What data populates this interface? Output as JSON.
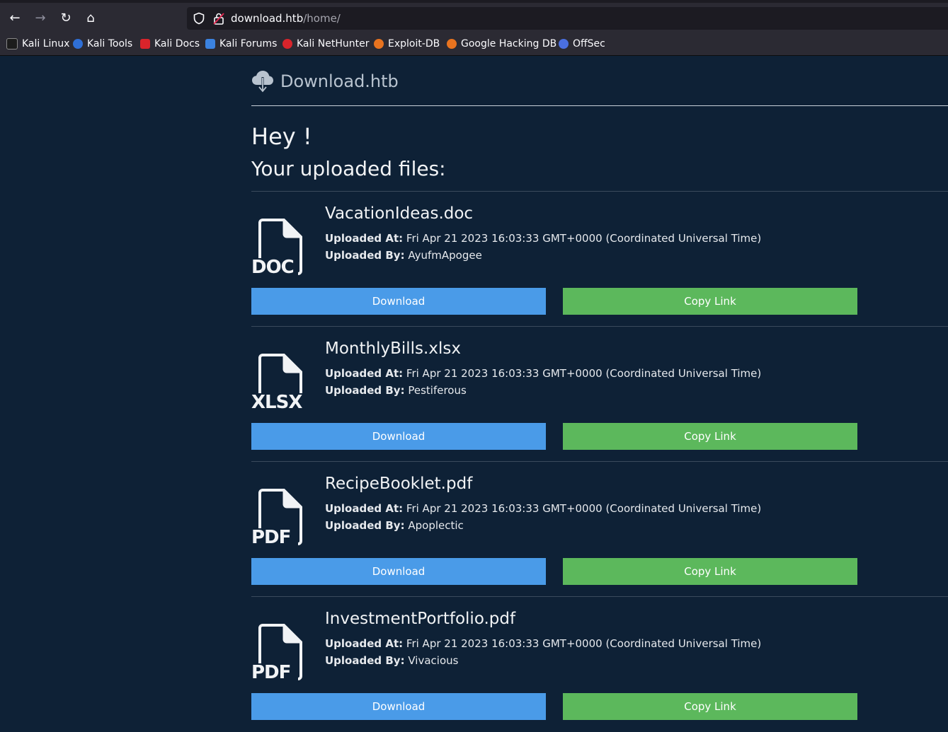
{
  "browser": {
    "url_host": "download.htb",
    "url_path": "/home/",
    "bookmarks": [
      {
        "label": "Kali Linux",
        "icon": "kali-dragon-icon",
        "color": "#1c1c1c"
      },
      {
        "label": "Kali Tools",
        "icon": "kali-tools-icon",
        "color": "#2f6fd6"
      },
      {
        "label": "Kali Docs",
        "icon": "kali-docs-icon",
        "color": "#d9242b"
      },
      {
        "label": "Kali Forums",
        "icon": "kali-forums-icon",
        "color": "#3b82e0"
      },
      {
        "label": "Kali NetHunter",
        "icon": "nethunter-icon",
        "color": "#d9242b"
      },
      {
        "label": "Exploit-DB",
        "icon": "exploit-db-icon",
        "color": "#e8731f"
      },
      {
        "label": "Google Hacking DB",
        "icon": "ghdb-icon",
        "color": "#e8731f"
      },
      {
        "label": "OffSec",
        "icon": "offsec-icon",
        "color": "#4a6fe0"
      }
    ]
  },
  "site": {
    "brand": "Download.htb",
    "greeting": "Hey !",
    "subtitle": "Your uploaded files:"
  },
  "labels": {
    "uploaded_at": "Uploaded At:",
    "uploaded_by": "Uploaded By:",
    "download": "Download",
    "copy_link": "Copy Link"
  },
  "files": [
    {
      "name": "VacationIdeas.doc",
      "ext": "DOC",
      "uploaded_at": "Fri Apr 21 2023 16:03:33 GMT+0000 (Coordinated Universal Time)",
      "uploaded_by": "AyufmApogee"
    },
    {
      "name": "MonthlyBills.xlsx",
      "ext": "XLSX",
      "uploaded_at": "Fri Apr 21 2023 16:03:33 GMT+0000 (Coordinated Universal Time)",
      "uploaded_by": "Pestiferous"
    },
    {
      "name": "RecipeBooklet.pdf",
      "ext": "PDF",
      "uploaded_at": "Fri Apr 21 2023 16:03:33 GMT+0000 (Coordinated Universal Time)",
      "uploaded_by": "Apoplectic"
    },
    {
      "name": "InvestmentPortfolio.pdf",
      "ext": "PDF",
      "uploaded_at": "Fri Apr 21 2023 16:03:33 GMT+0000 (Coordinated Universal Time)",
      "uploaded_by": "Vivacious"
    }
  ],
  "colors": {
    "page_bg": "#0e2136",
    "download_button": "#4a9be8",
    "copy_button": "#5cb85c"
  }
}
